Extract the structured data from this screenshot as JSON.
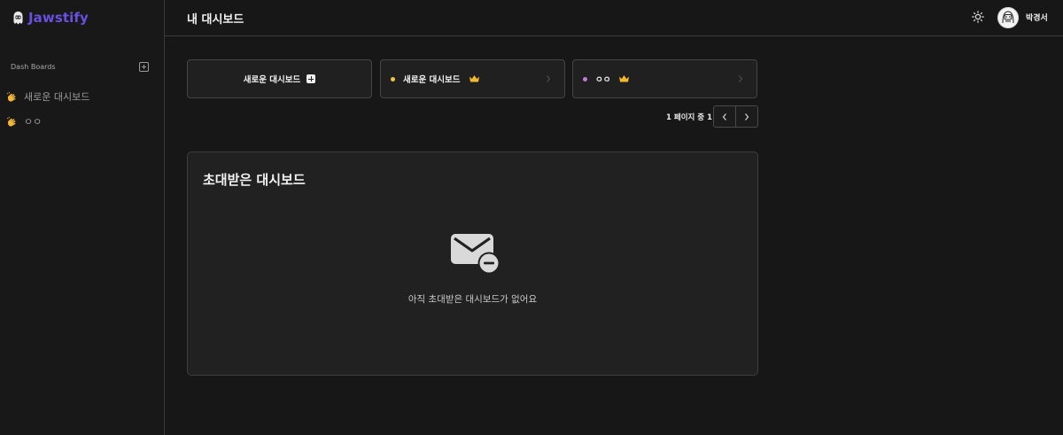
{
  "app": {
    "name": "Jawstify",
    "brand_color": "#6b4fe0"
  },
  "sidebar": {
    "section_label": "Dash Boards",
    "add_icon": "plus-square-icon",
    "items": [
      {
        "label": "새로운 대시보드",
        "icon": "waving-hand-icon"
      },
      {
        "label": "ㅇㅇ",
        "icon": "waving-hand-icon"
      }
    ]
  },
  "header": {
    "title": "내 대시보드",
    "theme_icon": "sun-icon",
    "user_name": "박경서"
  },
  "dashboards": {
    "new_label": "새로운 대시보드",
    "items": [
      {
        "label": "새로운 대시보드",
        "color": "#f5c542",
        "owner_icon": "crown-icon"
      },
      {
        "label": "ㅇㅇ",
        "color": "#c77ad6",
        "owner_icon": "crown-icon"
      }
    ]
  },
  "pagination": {
    "text": "1 페이지 중 1"
  },
  "invited": {
    "title": "초대받은 대시보드",
    "empty_icon": "mail-minus-icon",
    "empty_text": "아직 초대받은 대시보드가 없어요"
  }
}
